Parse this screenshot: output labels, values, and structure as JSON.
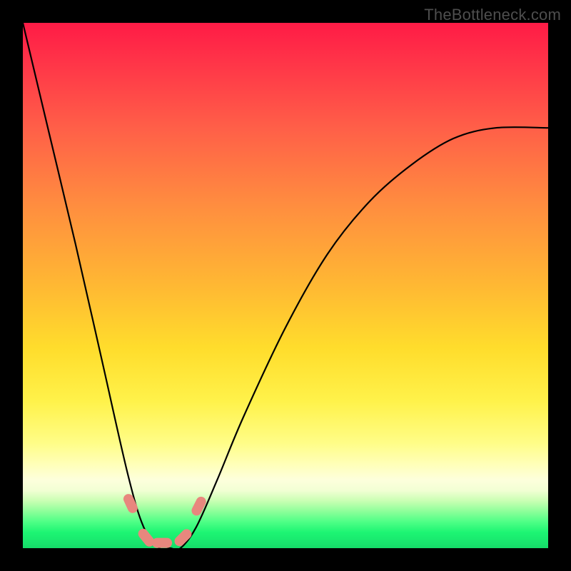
{
  "watermark": "TheBottleneck.com",
  "chart_data": {
    "type": "line",
    "title": "",
    "xlabel": "",
    "ylabel": "",
    "x": [
      0.0,
      0.05,
      0.1,
      0.15,
      0.2,
      0.23,
      0.26,
      0.28,
      0.3,
      0.33,
      0.37,
      0.42,
      0.5,
      0.58,
      0.66,
      0.74,
      0.82,
      0.9,
      1.0
    ],
    "y": [
      1.0,
      0.79,
      0.58,
      0.36,
      0.14,
      0.04,
      0.0,
      0.0,
      0.0,
      0.04,
      0.13,
      0.25,
      0.42,
      0.56,
      0.66,
      0.73,
      0.78,
      0.8,
      0.8
    ],
    "xlim": [
      0,
      1
    ],
    "ylim": [
      0,
      1
    ],
    "markers": {
      "x": [
        0.205,
        0.235,
        0.265,
        0.305,
        0.335
      ],
      "y": [
        0.085,
        0.02,
        0.01,
        0.02,
        0.08
      ]
    },
    "colors": {
      "curve": "#000000",
      "marker_fill": "#e8877e",
      "marker_stroke": "#cf5f57"
    }
  }
}
